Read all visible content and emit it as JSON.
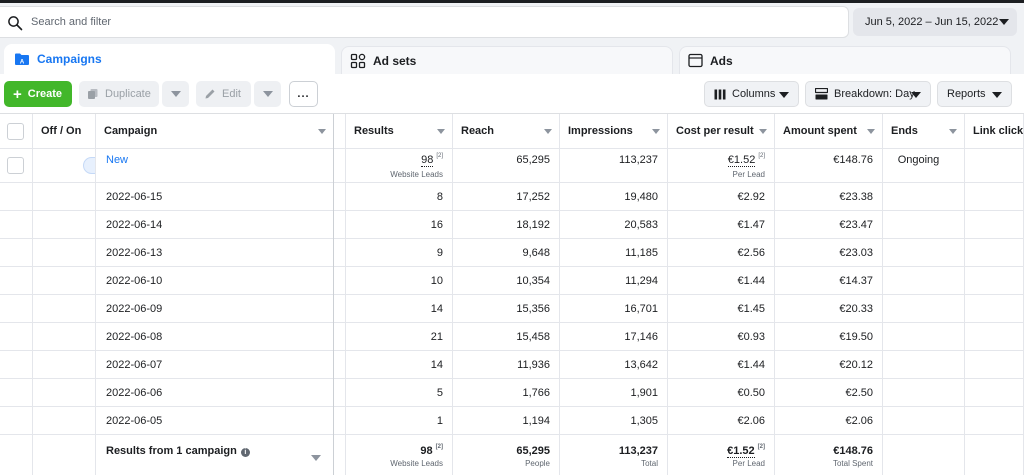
{
  "search": {
    "placeholder": "Search and filter"
  },
  "date_range": "Jun 5, 2022 – Jun 15, 2022",
  "tabs": [
    {
      "label": "Campaigns",
      "active": true
    },
    {
      "label": "Ad sets",
      "active": false
    },
    {
      "label": "Ads",
      "active": false
    }
  ],
  "toolbar": {
    "create_label": "Create",
    "duplicate_label": "Duplicate",
    "edit_label": "Edit",
    "more_label": "...",
    "columns_label": "Columns",
    "breakdown_label": "Breakdown: Day",
    "reports_label": "Reports"
  },
  "colors": {
    "accent": "#1877f2",
    "create": "#42b72a"
  },
  "table": {
    "headers": {
      "offon": "Off / On",
      "campaign": "Campaign",
      "results": "Results",
      "reach": "Reach",
      "impressions": "Impressions",
      "cpr": "Cost per result",
      "spent": "Amount spent",
      "ends": "Ends",
      "link_clicks": "Link click"
    },
    "campaign_row": {
      "name": "New",
      "results": "98",
      "results_sub": "Website Leads",
      "results_sup": "[2]",
      "reach": "65,295",
      "impressions": "113,237",
      "cpr": "€1.52",
      "cpr_sup": "[2]",
      "cpr_sub": "Per Lead",
      "spent": "€148.76",
      "ends": "Ongoing",
      "on": true
    },
    "rows": [
      {
        "date": "2022-06-15",
        "results": "8",
        "reach": "17,252",
        "impressions": "19,480",
        "cpr": "€2.92",
        "spent": "€23.38"
      },
      {
        "date": "2022-06-14",
        "results": "16",
        "reach": "18,192",
        "impressions": "20,583",
        "cpr": "€1.47",
        "spent": "€23.47"
      },
      {
        "date": "2022-06-13",
        "results": "9",
        "reach": "9,648",
        "impressions": "11,185",
        "cpr": "€2.56",
        "spent": "€23.03"
      },
      {
        "date": "2022-06-10",
        "results": "10",
        "reach": "10,354",
        "impressions": "11,294",
        "cpr": "€1.44",
        "spent": "€14.37"
      },
      {
        "date": "2022-06-09",
        "results": "14",
        "reach": "15,356",
        "impressions": "16,701",
        "cpr": "€1.45",
        "spent": "€20.33"
      },
      {
        "date": "2022-06-08",
        "results": "21",
        "reach": "15,458",
        "impressions": "17,146",
        "cpr": "€0.93",
        "spent": "€19.50"
      },
      {
        "date": "2022-06-07",
        "results": "14",
        "reach": "11,936",
        "impressions": "13,642",
        "cpr": "€1.44",
        "spent": "€20.12"
      },
      {
        "date": "2022-06-06",
        "results": "5",
        "reach": "1,766",
        "impressions": "1,901",
        "cpr": "€0.50",
        "spent": "€2.50"
      },
      {
        "date": "2022-06-05",
        "results": "1",
        "reach": "1,194",
        "impressions": "1,305",
        "cpr": "€2.06",
        "spent": "€2.06"
      }
    ],
    "totals": {
      "label": "Results from 1 campaign",
      "results": "98",
      "results_sup": "[2]",
      "results_sub": "Website Leads",
      "reach": "65,295",
      "reach_sub": "People",
      "impressions": "113,237",
      "impressions_sub": "Total",
      "cpr": "€1.52",
      "cpr_sup": "[2]",
      "cpr_sub": "Per Lead",
      "spent": "€148.76",
      "spent_sub": "Total Spent"
    }
  }
}
